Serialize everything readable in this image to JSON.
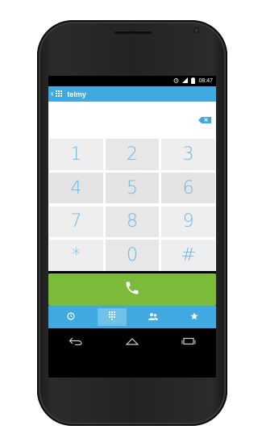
{
  "status_bar": {
    "alarm_icon": "alarm-icon",
    "signal_icon": "signal-icon",
    "battery_icon": "battery-icon",
    "time": "08:47"
  },
  "app_bar": {
    "back_icon": "back-chevron-icon",
    "logo_icon": "telmy-keypad-logo-icon",
    "title": "telmy"
  },
  "number_field": {
    "value": "",
    "delete_icon": "backspace-icon"
  },
  "keypad": {
    "keys": [
      "1",
      "2",
      "3",
      "4",
      "5",
      "6",
      "7",
      "8",
      "9",
      "*",
      "0",
      "#"
    ]
  },
  "call_button": {
    "icon": "phone-handset-icon"
  },
  "tabs": [
    {
      "icon": "clock-icon",
      "active": false
    },
    {
      "icon": "dialpad-icon",
      "active": true
    },
    {
      "icon": "contacts-icon",
      "active": false
    },
    {
      "icon": "star-icon",
      "active": false
    }
  ],
  "colors": {
    "accent": "#3fa9e0",
    "call_green": "#7cbb3a",
    "key_text": "#6fb8e4",
    "key_bg": "#eeeeee"
  }
}
